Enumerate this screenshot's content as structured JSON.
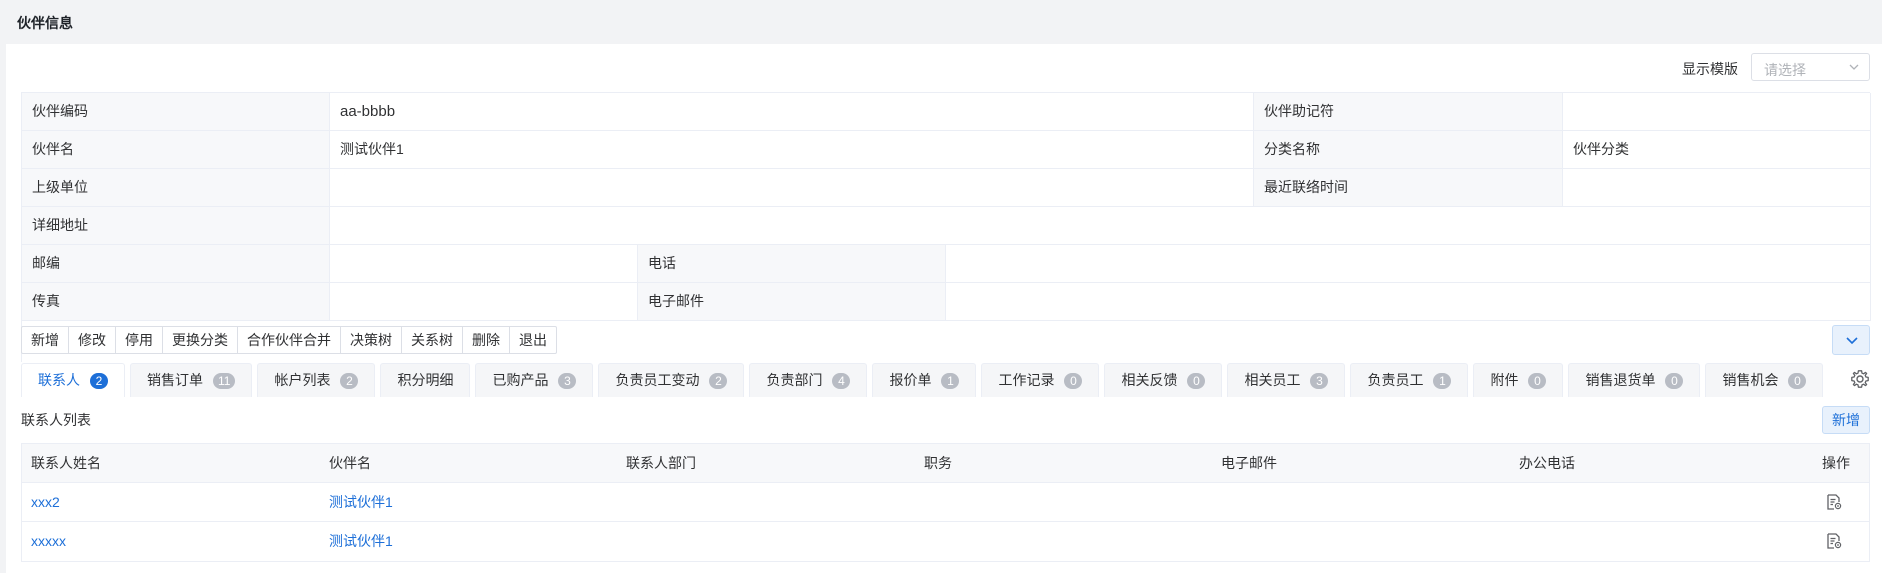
{
  "page": {
    "title": "伙伴信息"
  },
  "template": {
    "label": "显示模版",
    "placeholder": "请选择"
  },
  "info": {
    "code_label": "伙伴编码",
    "code_value": "aa-bbbb",
    "mnemonic_label": "伙伴助记符",
    "mnemonic_value": "",
    "name_label": "伙伴名",
    "name_value": "测试伙伴1",
    "category_label": "分类名称",
    "category_value": "伙伴分类",
    "parent_label": "上级单位",
    "parent_value": "",
    "last_contact_label": "最近联络时间",
    "last_contact_value": "",
    "address_label": "详细地址",
    "address_value": "",
    "zip_label": "邮编",
    "zip_value": "",
    "phone_label": "电话",
    "phone_value": "",
    "fax_label": "传真",
    "fax_value": "",
    "email_label": "电子邮件",
    "email_value": ""
  },
  "toolbar": {
    "buttons": [
      "新增",
      "修改",
      "停用",
      "更换分类",
      "合作伙伴合并",
      "决策树",
      "关系树",
      "删除",
      "退出"
    ]
  },
  "tabs": [
    {
      "label": "联系人",
      "count": "2"
    },
    {
      "label": "销售订单",
      "count": "11"
    },
    {
      "label": "帐户列表",
      "count": "2"
    },
    {
      "label": "积分明细",
      "count": ""
    },
    {
      "label": "已购产品",
      "count": "3"
    },
    {
      "label": "负责员工变动",
      "count": "2"
    },
    {
      "label": "负责部门",
      "count": "4"
    },
    {
      "label": "报价单",
      "count": "1"
    },
    {
      "label": "工作记录",
      "count": "0"
    },
    {
      "label": "相关反馈",
      "count": "0"
    },
    {
      "label": "相关员工",
      "count": "3"
    },
    {
      "label": "负责员工",
      "count": "1"
    },
    {
      "label": "附件",
      "count": "0"
    },
    {
      "label": "销售退货单",
      "count": "0"
    },
    {
      "label": "销售机会",
      "count": "0"
    }
  ],
  "contacts": {
    "title": "联系人列表",
    "add_label": "新增",
    "columns": {
      "name": "联系人姓名",
      "partner": "伙伴名",
      "dept": "联系人部门",
      "position": "职务",
      "email": "电子邮件",
      "phone": "办公电话",
      "ops": "操作"
    },
    "rows": [
      {
        "name": "xxx2",
        "partner": "测试伙伴1",
        "dept": "",
        "position": "",
        "email": "",
        "phone": ""
      },
      {
        "name": "xxxxx",
        "partner": "测试伙伴1",
        "dept": "",
        "position": "",
        "email": "",
        "phone": ""
      }
    ]
  },
  "colors": {
    "accent": "#1d6fd8",
    "badge_gray": "#b8bcc4"
  },
  "icons": {
    "select_chevron": "chevron-down-icon",
    "collapse": "chevron-down-icon",
    "settings": "gear-icon",
    "row_view": "document-view-icon"
  }
}
